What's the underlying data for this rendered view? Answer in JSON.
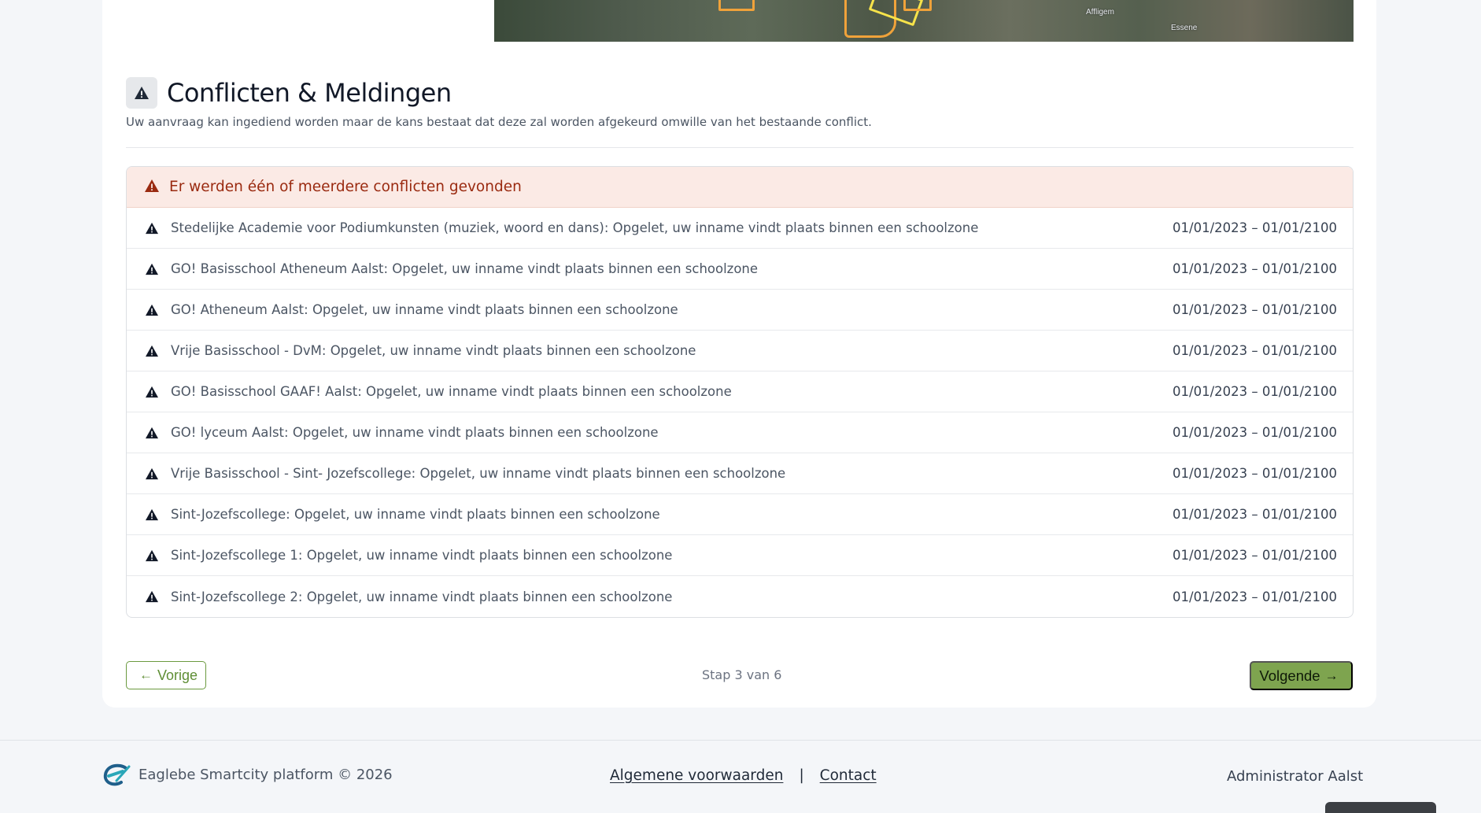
{
  "map": {
    "labels": [
      "Affligem",
      "Essene"
    ]
  },
  "section": {
    "icon": "warning-icon",
    "title": "Conflicten & Meldingen",
    "subtitle": "Uw aanvraag kan ingediend worden maar de kans bestaat dat deze zal worden afgekeurd omwille van het bestaande conflict."
  },
  "conflicts": {
    "header": "Er werden één of meerdere conflicten gevonden",
    "colors": {
      "header_bg": "#fbeae5",
      "header_text": "#9a2a10"
    },
    "items": [
      {
        "text": "Stedelijke Academie voor Podiumkunsten (muziek, woord en dans): Opgelet, uw inname vindt plaats binnen een schoolzone",
        "date": "01/01/2023 – 01/01/2100"
      },
      {
        "text": "GO! Basisschool Atheneum Aalst: Opgelet, uw inname vindt plaats binnen een schoolzone",
        "date": "01/01/2023 – 01/01/2100"
      },
      {
        "text": "GO! Atheneum Aalst: Opgelet, uw inname vindt plaats binnen een schoolzone",
        "date": "01/01/2023 – 01/01/2100"
      },
      {
        "text": "Vrije Basisschool - DvM: Opgelet, uw inname vindt plaats binnen een schoolzone",
        "date": "01/01/2023 – 01/01/2100"
      },
      {
        "text": "GO! Basisschool GAAF! Aalst: Opgelet, uw inname vindt plaats binnen een schoolzone",
        "date": "01/01/2023 – 01/01/2100"
      },
      {
        "text": "GO! lyceum Aalst: Opgelet, uw inname vindt plaats binnen een schoolzone",
        "date": "01/01/2023 – 01/01/2100"
      },
      {
        "text": "Vrije Basisschool - Sint- Jozefscollege: Opgelet, uw inname vindt plaats binnen een schoolzone",
        "date": "01/01/2023 – 01/01/2100"
      },
      {
        "text": "Sint-Jozefscollege: Opgelet, uw inname vindt plaats binnen een schoolzone",
        "date": "01/01/2023 – 01/01/2100"
      },
      {
        "text": "Sint-Jozefscollege 1: Opgelet, uw inname vindt plaats binnen een schoolzone",
        "date": "01/01/2023 – 01/01/2100"
      },
      {
        "text": "Sint-Jozefscollege 2: Opgelet, uw inname vindt plaats binnen een schoolzone",
        "date": "01/01/2023 – 01/01/2100"
      }
    ]
  },
  "navigation": {
    "prev_label": "Vorige",
    "next_label": "Volgende",
    "step_text": "Stap 3 van 6",
    "colors": {
      "accent": "#7ea44f"
    }
  },
  "footer": {
    "brand": "Eaglebe Smartcity platform © 2026",
    "link_terms": "Algemene voorwaarden",
    "separator": "|",
    "link_contact": "Contact",
    "user": "Administrator Aalst"
  }
}
